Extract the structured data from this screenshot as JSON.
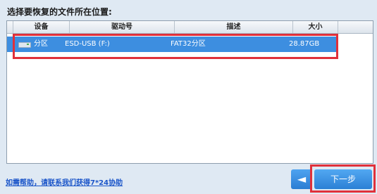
{
  "prompt": "选择要恢复的文件所在位置:",
  "table": {
    "columns": [
      "设备",
      "驱动号",
      "描述",
      "大小"
    ],
    "rows": [
      {
        "index": "1",
        "device": "分区",
        "drive": "ESD-USB (F:)",
        "description": "FAT32分区",
        "size": "28.87GB"
      }
    ]
  },
  "help_link": "如需帮助，请联系我们获得7*24协助",
  "buttons": {
    "back": "◄",
    "next": "下一步"
  },
  "colors": {
    "selection": "#3d8ee0",
    "highlight": "#e0303a",
    "button": "#2b80d5"
  },
  "icons": {
    "device": "disk-icon",
    "back": "arrow-left-icon"
  }
}
